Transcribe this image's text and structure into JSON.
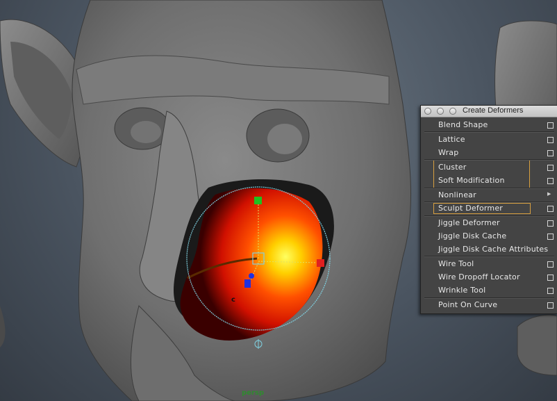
{
  "viewport": {
    "camera_label": "persp",
    "handle_label": "c"
  },
  "menu": {
    "title": "Create Deformers",
    "items": [
      {
        "label": "Blend Shape",
        "has_options": true
      },
      {
        "label": "Lattice",
        "has_options": true
      },
      {
        "label": "Wrap",
        "has_options": true
      },
      {
        "label": "Cluster",
        "has_options": true,
        "highlighted": true
      },
      {
        "label": "Soft Modification",
        "has_options": true,
        "highlighted": true
      },
      {
        "label": "Nonlinear",
        "submenu": true
      },
      {
        "label": "Sculpt Deformer",
        "has_options": true,
        "highlighted": true
      },
      {
        "label": "Jiggle Deformer",
        "has_options": true
      },
      {
        "label": "Jiggle Disk Cache",
        "has_options": true
      },
      {
        "label": "Jiggle Disk Cache Attributes"
      },
      {
        "label": "Wire Tool",
        "has_options": true
      },
      {
        "label": "Wire Dropoff Locator",
        "has_options": true
      },
      {
        "label": "Wrinkle Tool",
        "has_options": true
      },
      {
        "label": "Point On Curve",
        "has_options": true
      }
    ]
  },
  "colors": {
    "highlight_border": "#d8a040",
    "manip_x": "#e02020",
    "manip_y": "#20c020",
    "manip_z": "#2030e0",
    "falloff_circle": "#7fd0e0"
  }
}
